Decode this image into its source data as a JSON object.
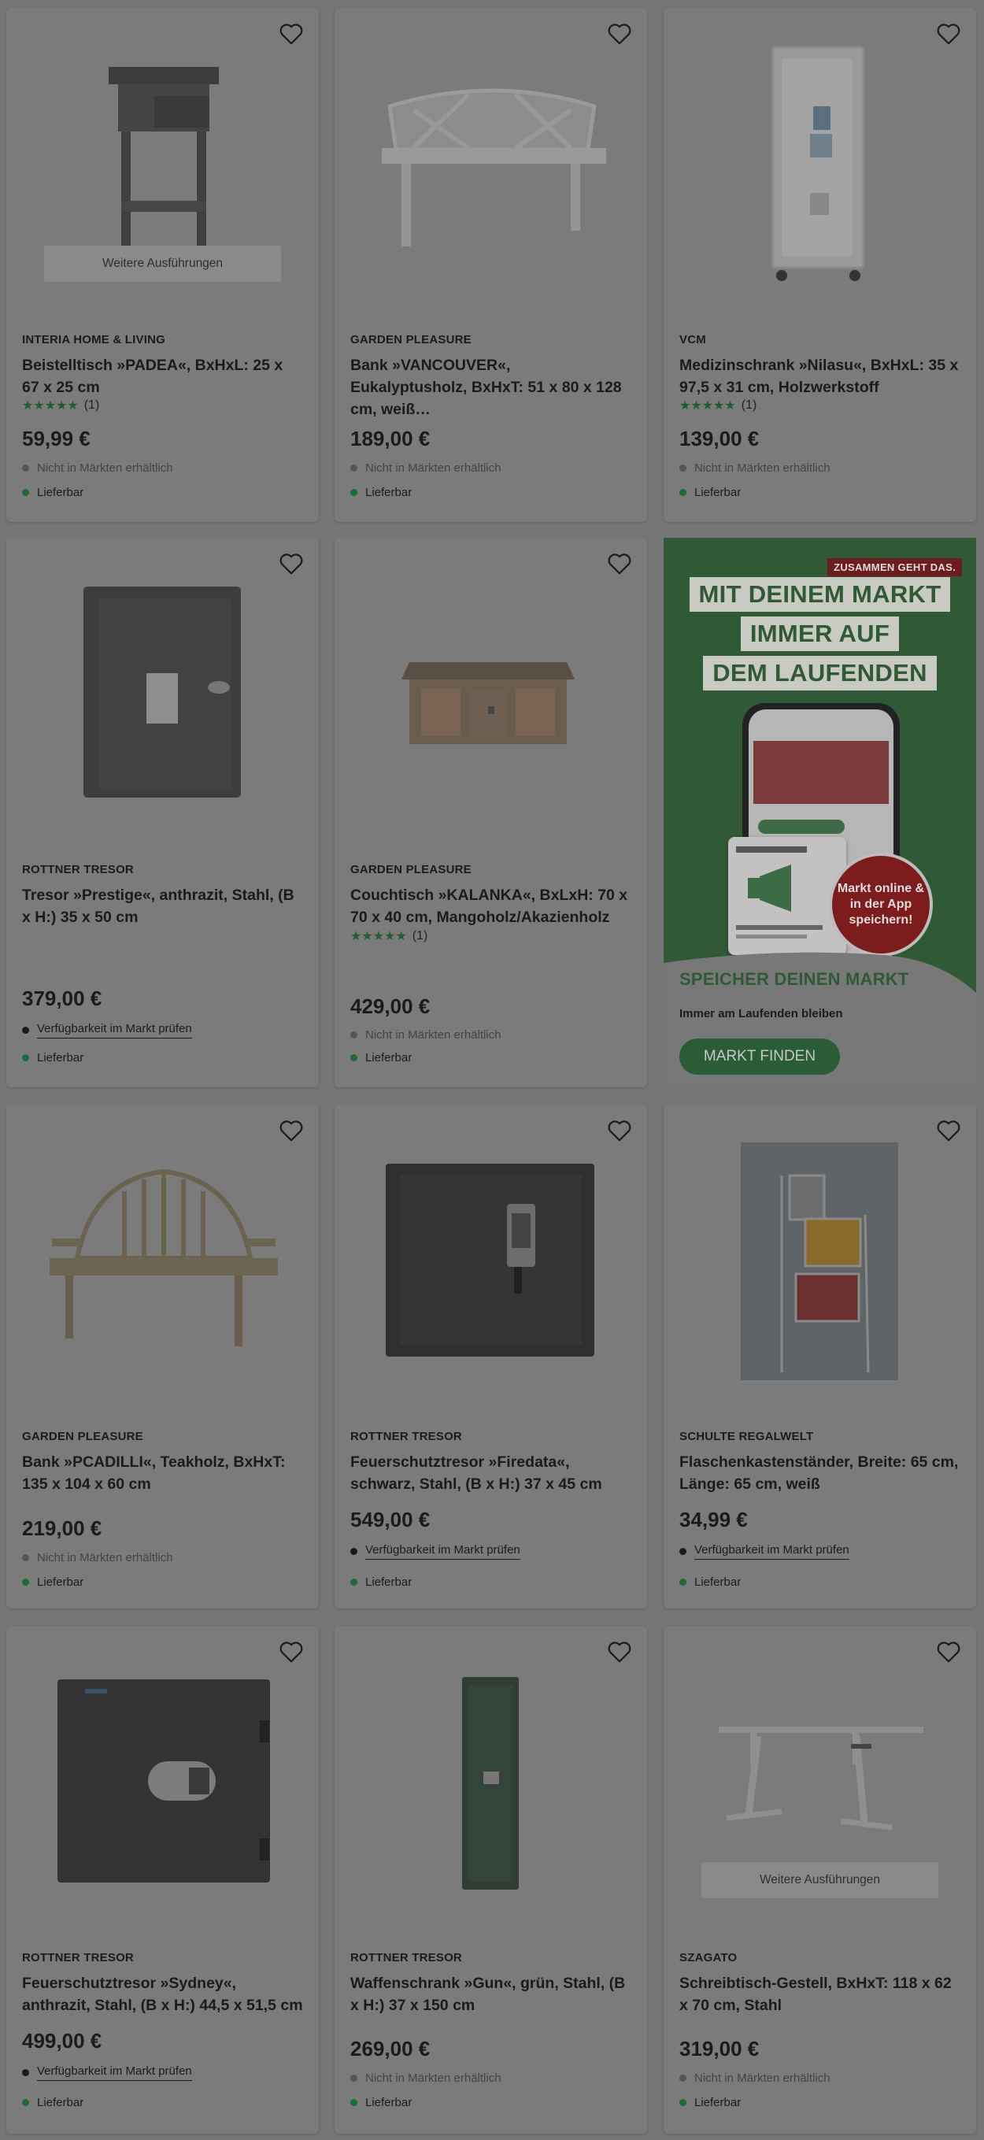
{
  "variants_label": "Weitere Ausführungen",
  "products": [
    {
      "brand": "INTERIA HOME & LIVING",
      "title": "Beistelltisch »PADEA«, BxHxL: 25 x 67 x 25 cm",
      "rating_count": "(1)",
      "price": "59,99 €",
      "availability": "Nicht in Märkten erhältlich",
      "delivery": "Lieferbar",
      "image": "side-table"
    },
    {
      "brand": "GARDEN PLEASURE",
      "title": "Bank »VANCOUVER«, Eukalyptusholz, BxHxT: 51 x 80 x 128 cm, weiß…",
      "price": "189,00 €",
      "availability": "Nicht in Märkten erhältlich",
      "delivery": "Lieferbar",
      "image": "white-bench"
    },
    {
      "brand": "VCM",
      "title": "Medizinschrank »Nilasu«, BxHxL: 35 x 97,5 x 31 cm, Holzwerkstoff",
      "rating_count": "(1)",
      "price": "139,00 €",
      "availability": "Nicht in Märkten erhältlich",
      "delivery": "Lieferbar",
      "image": "medicine-cabinet"
    },
    {
      "brand": "ROTTNER TRESOR",
      "title": "Tresor »Prestige«, anthrazit, Stahl, (B x H:) 35 x 50 cm",
      "price": "379,00 €",
      "availability": "Verfügbarkeit im Markt prüfen",
      "delivery": "Lieferbar",
      "image": "safe-prestige"
    },
    {
      "brand": "GARDEN PLEASURE",
      "title": "Couchtisch »KALANKA«, BxLxH: 70 x 70 x 40 cm, Mangoholz/Akazienholz",
      "rating_count": "(1)",
      "price": "429,00 €",
      "availability": "Nicht in Märkten erhältlich",
      "delivery": "Lieferbar",
      "image": "coffee-table-chest"
    },
    {
      "brand": "GARDEN PLEASURE",
      "title": "Bank »PCADILLI«, Teakholz, BxHxT: 135 x 104 x 60 cm",
      "price": "219,00 €",
      "availability": "Nicht in Märkten erhältlich",
      "delivery": "Lieferbar",
      "image": "teak-bench"
    },
    {
      "brand": "ROTTNER TRESOR",
      "title": "Feuerschutztresor »Firedata«, schwarz, Stahl, (B x H:) 37 x 45 cm",
      "price": "549,00 €",
      "availability": "Verfügbarkeit im Markt prüfen",
      "delivery": "Lieferbar",
      "image": "safe-firedata"
    },
    {
      "brand": "SCHULTE REGALWELT",
      "title": "Flaschenkastenständer, Breite: 65 cm, Länge: 65 cm, weiß",
      "price": "34,99 €",
      "availability": "Verfügbarkeit im Markt prüfen",
      "delivery": "Lieferbar",
      "image": "crate-stand"
    },
    {
      "brand": "ROTTNER TRESOR",
      "title": "Feuerschutztresor »Sydney«, anthrazit, Stahl, (B x H:) 44,5 x 51,5 cm",
      "price": "499,00 €",
      "availability": "Verfügbarkeit im Markt prüfen",
      "delivery": "Lieferbar",
      "image": "safe-sydney"
    },
    {
      "brand": "ROTTNER TRESOR",
      "title": "Waffenschrank »Gun«, grün, Stahl, (B x H:) 37 x 150 cm",
      "price": "269,00 €",
      "availability": "Nicht in Märkten erhältlich",
      "delivery": "Lieferbar",
      "image": "gun-cabinet"
    },
    {
      "brand": "SZAGATO",
      "title": "Schreibtisch-Gestell, BxHxT: 118 x 62 x 70 cm, Stahl",
      "price": "319,00 €",
      "availability": "Nicht in Märkten erhältlich",
      "delivery": "Lieferbar",
      "image": "desk-frame"
    }
  ],
  "promo": {
    "tagline": "ZUSAMMEN GEHT DAS.",
    "headline": [
      "MIT DEINEM MARKT",
      "IMMER AUF",
      "DEM LAUFENDEN"
    ],
    "badge": "Markt online & in der App speichern!",
    "title": "SPEICHER DEINEN MARKT",
    "subtitle": "Immer am Laufenden bleiben",
    "button": "MARKT FINDEN"
  },
  "colors": {
    "overlay": "#767676",
    "promo_green": "#2f5a35",
    "accent_red": "#7d1c1c",
    "delivery_green": "#1f6b36"
  }
}
